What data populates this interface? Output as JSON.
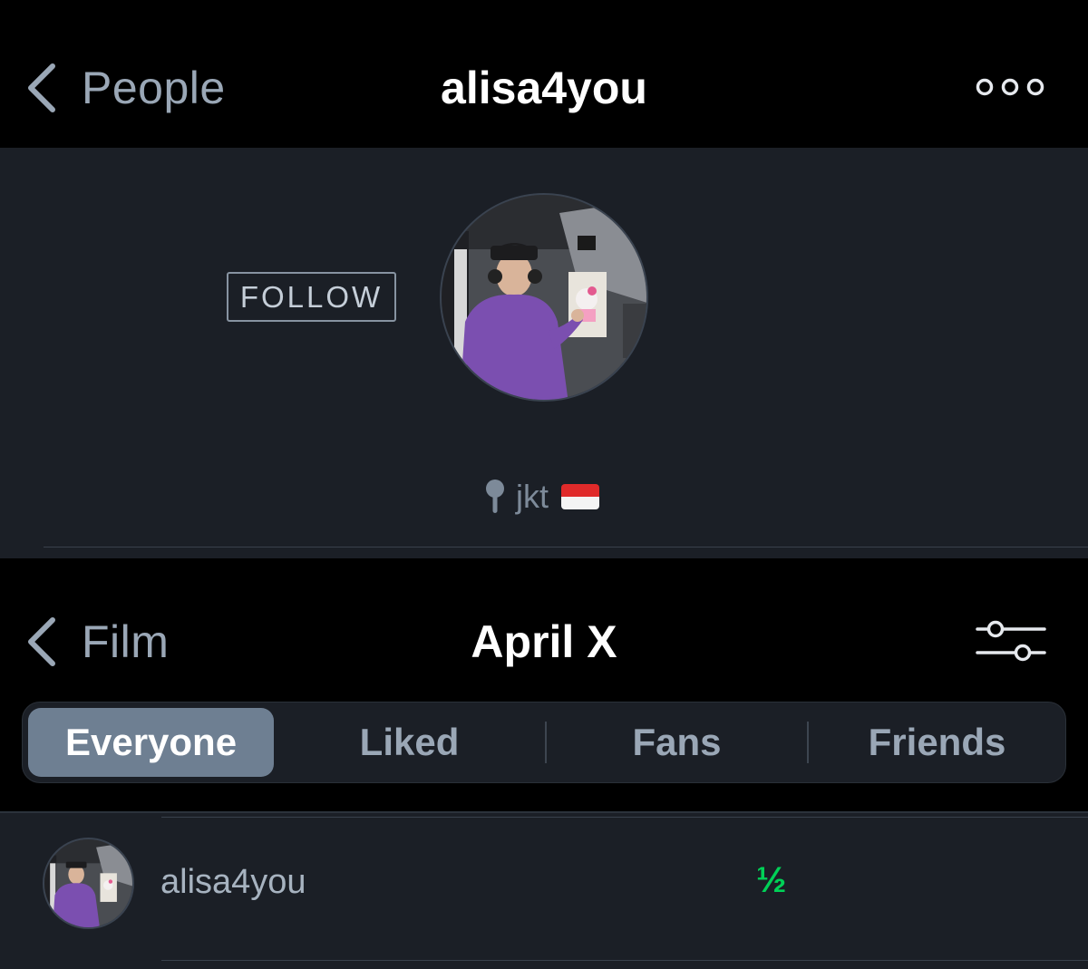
{
  "profile_nav": {
    "back_label": "People",
    "title": "alisa4you"
  },
  "profile": {
    "follow_label": "FOLLOW",
    "location": "jkt",
    "flag": "indonesia-flag"
  },
  "film_nav": {
    "back_label": "Film",
    "title": "April X"
  },
  "tabs": [
    {
      "label": "Everyone",
      "selected": true
    },
    {
      "label": "Liked",
      "selected": false
    },
    {
      "label": "Fans",
      "selected": false
    },
    {
      "label": "Friends",
      "selected": false
    }
  ],
  "entries": [
    {
      "username": "alisa4you",
      "rating": "½"
    }
  ],
  "colors": {
    "background": "#000000",
    "panel": "#1b1f26",
    "selected_tab": "#6e7f92",
    "rating_green": "#00d157"
  }
}
